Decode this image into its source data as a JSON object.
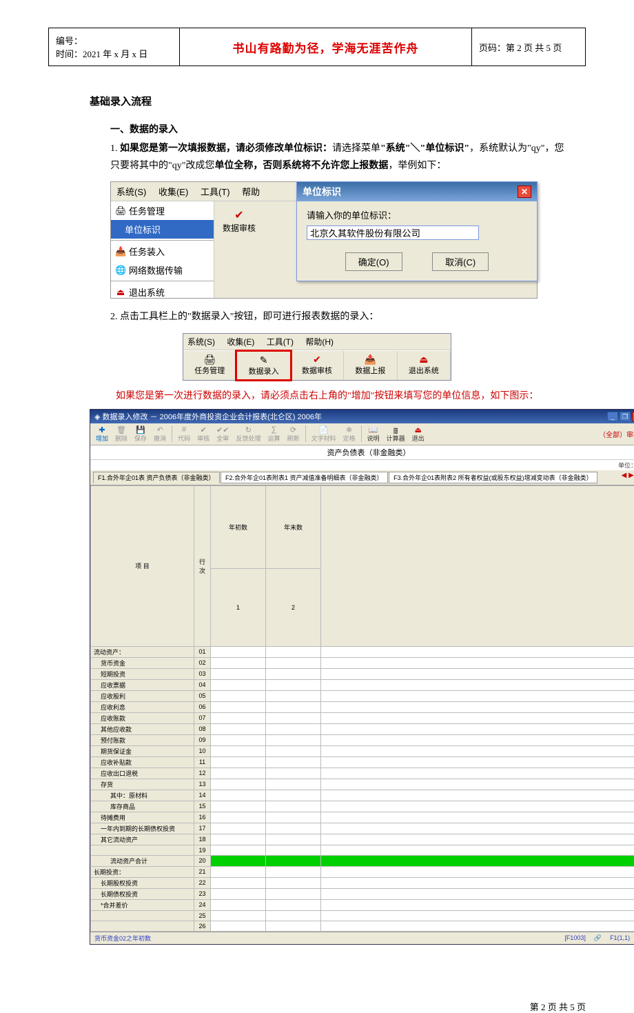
{
  "header": {
    "left_line1": "编号：",
    "left_line2": "时间：2021 年 x 月 x 日",
    "center": "书山有路勤为径，学海无涯苦作舟",
    "right": "页码：第 2 页 共 5 页"
  },
  "section_title": "基础录入流程",
  "sec1": {
    "subtitle": "一、数据的录入",
    "item1_pre": "1.  ",
    "item1_bold1": "如果您是第一次填报数据，请必须修改单位标识：",
    "item1_txt1": "请选择菜单",
    "item1_bold2": "\"系统\"＼\"单位标识\"",
    "item1_txt2": "，系统默认为\"qy\"，您只要将其中的\"qy\"改成您",
    "item1_bold3": "单位全称，否则系统将不允许您上报数据",
    "item1_txt3": "，举例如下："
  },
  "shot1": {
    "menubar": [
      "系统(S)",
      "收集(E)",
      "工具(T)",
      "帮助"
    ],
    "menu_items": {
      "m1": "任务管理",
      "m2_sel": "单位标识",
      "m3": "任务装入",
      "m4": "网络数据传输",
      "m5": "退出系统"
    },
    "tb_btn": "数据审核",
    "dlg": {
      "title": "单位标识",
      "prompt": "请输入你的单位标识：",
      "value": "北京久其软件股份有限公司",
      "ok": "确定(O)",
      "cancel": "取消(C)"
    }
  },
  "sec1_item2": "2.  点击工具栏上的\"数据录入\"按钮，即可进行报表数据的录入：",
  "shot2": {
    "menubar": [
      "系统(S)",
      "收集(E)",
      "工具(T)",
      "帮助(H)"
    ],
    "buttons": [
      "任务管理",
      "数据录入",
      "数据审核",
      "数据上报",
      "退出系统"
    ]
  },
  "red_para": "如果您是第一次进行数据的录入，请必须点击右上角的\"增加\"按钮来填写您的单位信息，如下图示：",
  "shot3": {
    "title": "数据录入修改 － 2006年度外商投资企业会计报表(北仑区) 2006年",
    "toolbar": [
      "增加",
      "删除",
      "保存",
      "撤消",
      "代码",
      "审核",
      "全审",
      "反馈处理",
      "运算",
      "刷新",
      "文字材料",
      "定格",
      "说明",
      "计算器",
      "退出"
    ],
    "right_info": "（全部）审核",
    "sheet_title": "资产负债表（非金融类）",
    "unit": "单位：元",
    "tabs": [
      "F1.合外年企01表  资产负债表（非金融类）",
      "F2.合外年企01表附表1  资产减值准备明细表（非金融类）",
      "F3.合外年企01表附表2  所有者权益(或股东权益)增减变动表（非金融类）"
    ],
    "cols": {
      "item": "项    目",
      "rn": "行次",
      "c1": "年初数",
      "c2": "年末数"
    },
    "subcols": {
      "c1": "1",
      "c2": "2"
    },
    "rows": [
      {
        "label": "流动资产：",
        "rn": "01",
        "pad": 0
      },
      {
        "label": "货币资金",
        "rn": "02",
        "pad": 1
      },
      {
        "label": "短期投资",
        "rn": "03",
        "pad": 1
      },
      {
        "label": "应收票据",
        "rn": "04",
        "pad": 1
      },
      {
        "label": "应收股利",
        "rn": "05",
        "pad": 1
      },
      {
        "label": "应收利息",
        "rn": "06",
        "pad": 1
      },
      {
        "label": "应收账款",
        "rn": "07",
        "pad": 1
      },
      {
        "label": "其他应收款",
        "rn": "08",
        "pad": 1
      },
      {
        "label": "预付账款",
        "rn": "09",
        "pad": 1
      },
      {
        "label": "期货保证金",
        "rn": "10",
        "pad": 1
      },
      {
        "label": "应收补贴款",
        "rn": "11",
        "pad": 1
      },
      {
        "label": "应收出口退税",
        "rn": "12",
        "pad": 1
      },
      {
        "label": "存货",
        "rn": "13",
        "pad": 1
      },
      {
        "label": "其中：原材料",
        "rn": "14",
        "pad": 2
      },
      {
        "label": "库存商品",
        "rn": "15",
        "pad": 2
      },
      {
        "label": "待摊费用",
        "rn": "16",
        "pad": 1
      },
      {
        "label": "一年内到期的长期债权投资",
        "rn": "17",
        "pad": 1
      },
      {
        "label": "其它流动资产",
        "rn": "18",
        "pad": 1
      },
      {
        "label": "",
        "rn": "19",
        "pad": 0
      },
      {
        "label": "流动资产合计",
        "rn": "20",
        "pad": 2,
        "green": true
      },
      {
        "label": "长期投资：",
        "rn": "21",
        "pad": 0
      },
      {
        "label": "长期股权投资",
        "rn": "22",
        "pad": 1
      },
      {
        "label": "长期债权投资",
        "rn": "23",
        "pad": 1
      },
      {
        "label": "*合并差价",
        "rn": "24",
        "pad": 1
      },
      {
        "label": "",
        "rn": "25",
        "pad": 0
      },
      {
        "label": "",
        "rn": "26",
        "pad": 0
      }
    ],
    "status_left": "货币资金02之年初数",
    "status_mid": "[F1003]",
    "status_right": "F1(1,1)"
  },
  "footer": "第 2 页 共 5 页"
}
